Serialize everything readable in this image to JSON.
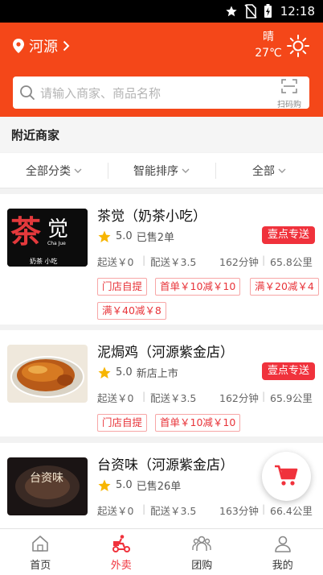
{
  "status_bar": {
    "time": "12:18"
  },
  "header": {
    "city": "河源",
    "weather": {
      "condition": "晴",
      "temperature": "27℃"
    },
    "search": {
      "placeholder": "请输入商家、商品名称",
      "scan_label": "扫码购"
    }
  },
  "section_title": "附近商家",
  "filters": [
    {
      "label": "全部分类"
    },
    {
      "label": "智能排序"
    },
    {
      "label": "全部"
    }
  ],
  "merchants": [
    {
      "name": "茶觉（奶茶小吃）",
      "logo_text": "茶觉",
      "logo_subtext": "Cha Jue",
      "logo_caption": "奶茶 小吃",
      "rating": "5.0",
      "sales": "已售2单",
      "delivery_badge": "壹点专送",
      "min_order": "起送￥0",
      "delivery_fee": "配送￥3.5",
      "time": "162分钟",
      "distance": "65.8公里",
      "promos": [
        "门店自提",
        "首单￥10减￥10",
        "满￥20减￥4",
        "满￥40减￥8"
      ]
    },
    {
      "name": "泥焗鸡（河源紫金店）",
      "rating": "5.0",
      "sales": "新店上市",
      "delivery_badge": "壹点专送",
      "min_order": "起送￥0",
      "delivery_fee": "配送￥3.5",
      "time": "162分钟",
      "distance": "65.9公里",
      "promos": [
        "门店自提",
        "首单￥10减￥10"
      ]
    },
    {
      "name": "台资味（河源紫金店）",
      "logo_text": "台资味",
      "rating": "5.0",
      "sales": "已售26单",
      "min_order": "起送￥0",
      "delivery_fee": "配送￥3.5",
      "time": "163分钟",
      "distance": "66.4公里"
    }
  ],
  "bottom_nav": [
    {
      "label": "首页",
      "icon": "home-icon"
    },
    {
      "label": "外卖",
      "icon": "delivery-scooter-icon",
      "active": true
    },
    {
      "label": "团购",
      "icon": "group-buy-icon"
    },
    {
      "label": "我的",
      "icon": "profile-icon"
    }
  ],
  "colors": {
    "primary": "#f44719",
    "accent_red": "#f0323c",
    "star": "#f7b500"
  }
}
